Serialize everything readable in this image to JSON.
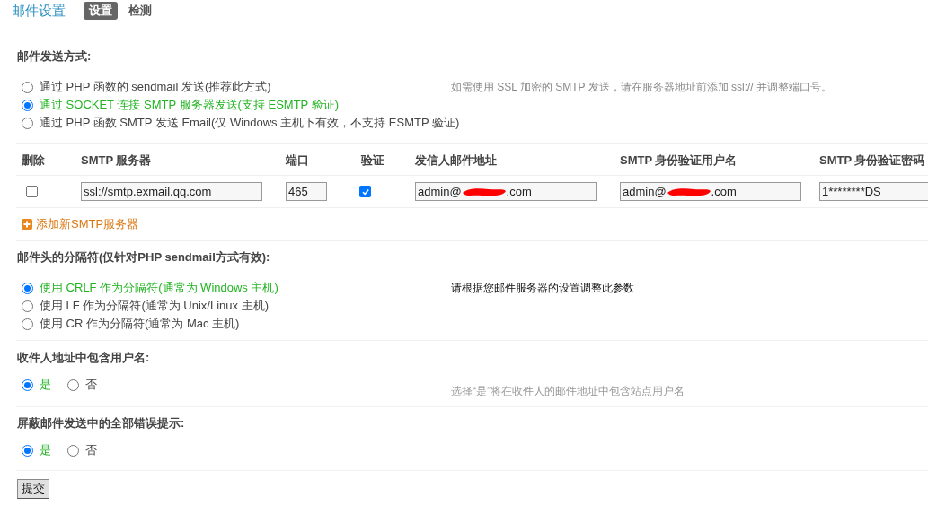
{
  "header": {
    "title": "邮件设置",
    "tabs": [
      {
        "label": "设置",
        "selected": true
      },
      {
        "label": "检测",
        "selected": false
      }
    ]
  },
  "send_method": {
    "heading": "邮件发送方式:",
    "hint": "如需使用 SSL 加密的 SMTP 发送，请在服务器地址前添加 ssl:// 并调整端口号。",
    "options": [
      {
        "label": "通过 PHP 函数的 sendmail 发送(推荐此方式)",
        "selected": false
      },
      {
        "label": "通过 SOCKET 连接 SMTP 服务器发送(支持 ESMTP 验证)",
        "selected": true
      },
      {
        "label": "通过 PHP 函数 SMTP 发送 Email(仅 Windows 主机下有效，不支持 ESMTP 验证)",
        "selected": false
      }
    ]
  },
  "smtp_table": {
    "columns": [
      "删除",
      "SMTP 服务器",
      "端口",
      "验证",
      "发信人邮件地址",
      "SMTP 身份验证用户名",
      "SMTP 身份验证密码"
    ],
    "rows": [
      {
        "delete_checked": false,
        "server": "ssl://smtp.exmail.qq.com",
        "port": "465",
        "auth_checked": true,
        "sender": {
          "start": "admin@",
          "end": ".com",
          "redacted": true
        },
        "username": {
          "start": "admin@",
          "end": ".com",
          "redacted": true
        },
        "password": "1********DS"
      }
    ],
    "add_link": "添加新SMTP服务器"
  },
  "separator": {
    "heading": "邮件头的分隔符(仅针对PHP sendmail方式有效):",
    "hint": "请根据您邮件服务器的设置调整此参数",
    "options": [
      {
        "label": "使用 CRLF 作为分隔符(通常为 Windows 主机)",
        "selected": true
      },
      {
        "label": "使用 LF 作为分隔符(通常为 Unix/Linux 主机)",
        "selected": false
      },
      {
        "label": "使用 CR 作为分隔符(通常为 Mac 主机)",
        "selected": false
      }
    ]
  },
  "include_username": {
    "heading": "收件人地址中包含用户名:",
    "hint": "选择“是”将在收件人的邮件地址中包含站点用户名",
    "options": [
      {
        "label": "是",
        "selected": true
      },
      {
        "label": "否",
        "selected": false
      }
    ]
  },
  "silent_errors": {
    "heading": "屏蔽邮件发送中的全部错误提示:",
    "options": [
      {
        "label": "是",
        "selected": true
      },
      {
        "label": "否",
        "selected": false
      }
    ]
  },
  "submit": "提交"
}
